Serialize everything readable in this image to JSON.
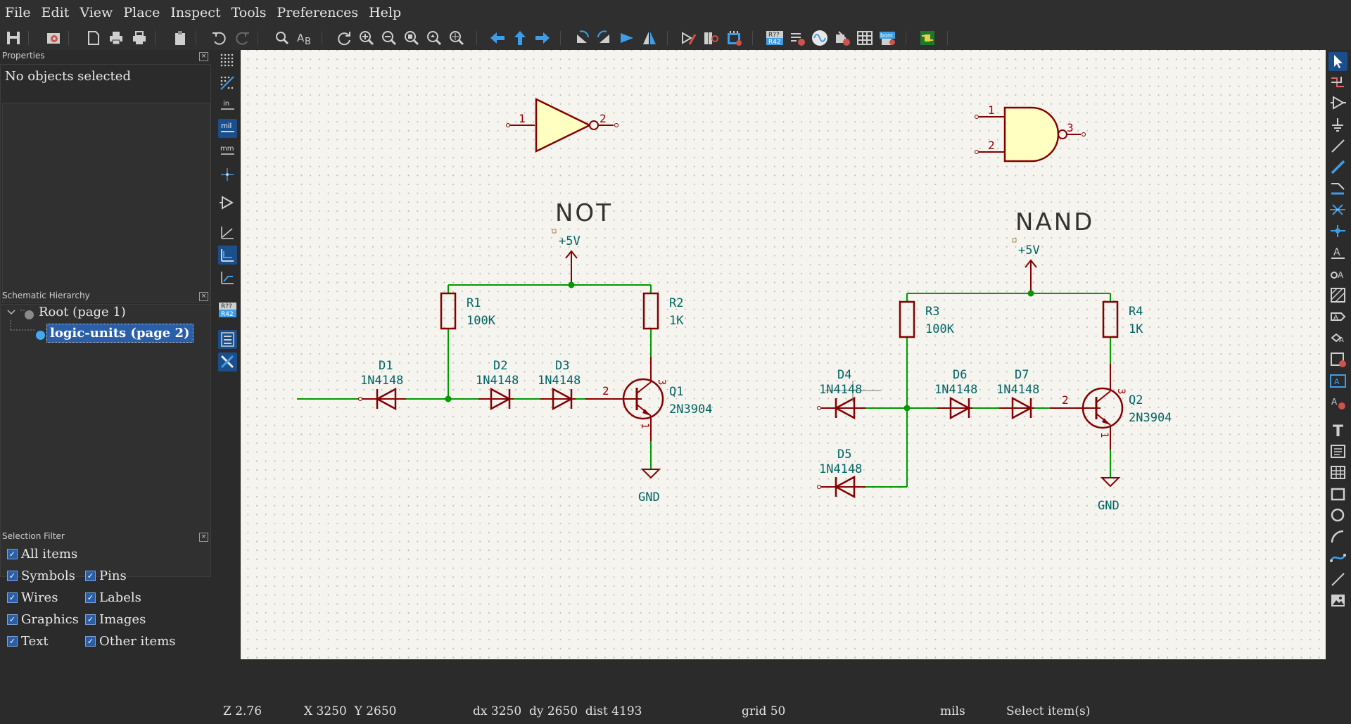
{
  "menu": [
    "File",
    "Edit",
    "View",
    "Place",
    "Inspect",
    "Tools",
    "Preferences",
    "Help"
  ],
  "toolbar_icons": [
    "save-icon",
    "schematic-setup-icon",
    "page-settings-icon",
    "print-icon",
    "plot-icon",
    "paste-icon",
    "undo-icon",
    "redo-icon",
    "find-icon",
    "find-replace-icon",
    "refresh-icon",
    "zoom-in-icon",
    "zoom-out-icon",
    "zoom-fit-icon",
    "zoom-objects-icon",
    "zoom-selection-icon",
    "navigate-back-icon",
    "navigate-up-icon",
    "navigate-forward-icon",
    "rotate-ccw-icon",
    "rotate-cw-icon",
    "mirror-vertical-icon",
    "mirror-horizontal-icon",
    "symbol-editor-icon",
    "symbol-browser-icon",
    "footprint-assign-icon",
    "annotate-icon",
    "erc-icon",
    "simulator-icon",
    "assign-footprints-icon",
    "bom-table-icon",
    "generate-bom-icon",
    "pcb-editor-icon"
  ],
  "properties": {
    "title": "Properties",
    "empty_text": "No objects selected"
  },
  "hierarchy": {
    "title": "Schematic Hierarchy",
    "root": "Root (page 1)",
    "child": "logic-units (page 2)"
  },
  "filter": {
    "title": "Selection Filter",
    "items": [
      "All items",
      "Symbols",
      "Pins",
      "Wires",
      "Labels",
      "Graphics",
      "Images",
      "Text",
      "Other items"
    ]
  },
  "left_tools": {
    "unit_in": "in",
    "unit_mil": "mil",
    "unit_mm": "mm",
    "ref_badge_top": "R??",
    "ref_badge_bottom": "R42"
  },
  "toolbar_badges": {
    "annotate_top": "R??",
    "annotate_bottom": "R42",
    "bom": "bom"
  },
  "schematic": {
    "not_label": "NOT",
    "nand_label": "NAND",
    "not_pins": [
      "1",
      "2"
    ],
    "nand_pins": [
      "1",
      "2",
      "3"
    ],
    "power": "+5V",
    "ground": "GND",
    "components": {
      "R1": {
        "ref": "R1",
        "value": "100K"
      },
      "R2": {
        "ref": "R2",
        "value": "1K"
      },
      "R3": {
        "ref": "R3",
        "value": "100K"
      },
      "R4": {
        "ref": "R4",
        "value": "1K"
      },
      "D1": {
        "ref": "D1",
        "value": "1N4148"
      },
      "D2": {
        "ref": "D2",
        "value": "1N4148"
      },
      "D3": {
        "ref": "D3",
        "value": "1N4148"
      },
      "D4": {
        "ref": "D4",
        "value": "1N4148"
      },
      "D5": {
        "ref": "D5",
        "value": "1N4148"
      },
      "D6": {
        "ref": "D6",
        "value": "1N4148"
      },
      "D7": {
        "ref": "D7",
        "value": "1N4148"
      },
      "Q1": {
        "ref": "Q1",
        "value": "2N3904"
      },
      "Q2": {
        "ref": "Q2",
        "value": "2N3904"
      }
    },
    "transistor_pins": {
      "base": "2",
      "collector": "3",
      "emitter": "1"
    },
    "colors": {
      "wire": "#009900",
      "symbol": "#840000",
      "body_fill": "#ffffc2",
      "text": "#006464",
      "junction": "#009900"
    }
  },
  "status": {
    "zoom": "Z 2.76",
    "xy": "X 3250  Y 2650",
    "delta": "dx 3250  dy 2650  dist 4193",
    "grid": "grid 50",
    "units": "mils",
    "message": "Select item(s)"
  }
}
